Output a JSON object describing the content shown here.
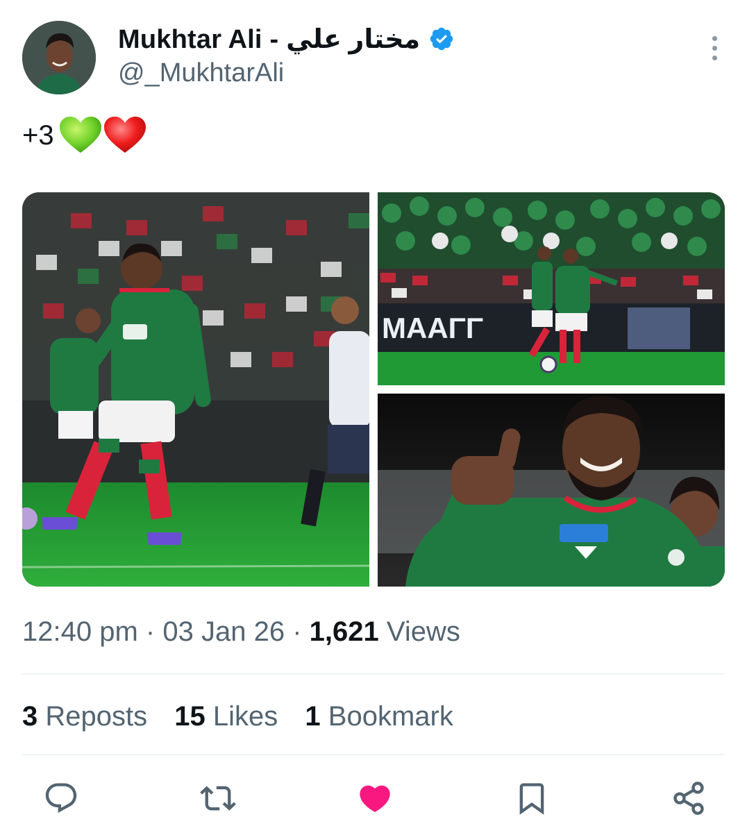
{
  "author": {
    "display_name": "Mukhtar Ali - مختار علي",
    "handle": "@_MukhtarAli",
    "verified": true,
    "verified_color": "#1d9bf0"
  },
  "tweet": {
    "text": "+3",
    "emojis": [
      "green-heart",
      "red-heart"
    ]
  },
  "media": {
    "count": 3,
    "banner_text": "MAAΓΓ"
  },
  "meta": {
    "time": "12:40 pm",
    "separator": "·",
    "date": "03 Jan 26",
    "views_count": "1,621",
    "views_label": "Views"
  },
  "stats": {
    "reposts_count": "3",
    "reposts_label": "Reposts",
    "likes_count": "15",
    "likes_label": "Likes",
    "bookmarks_count": "1",
    "bookmarks_label": "Bookmark"
  },
  "actions": [
    {
      "name": "reply",
      "icon": "reply-icon"
    },
    {
      "name": "repost",
      "icon": "repost-icon"
    },
    {
      "name": "like",
      "icon": "heart-icon",
      "active": true,
      "color": "#f91880"
    },
    {
      "name": "bookmark",
      "icon": "bookmark-icon"
    },
    {
      "name": "share",
      "icon": "share-icon"
    }
  ],
  "colors": {
    "text_primary": "#0f1419",
    "text_secondary": "#536471",
    "like": "#f91880",
    "icon": "#536471"
  }
}
